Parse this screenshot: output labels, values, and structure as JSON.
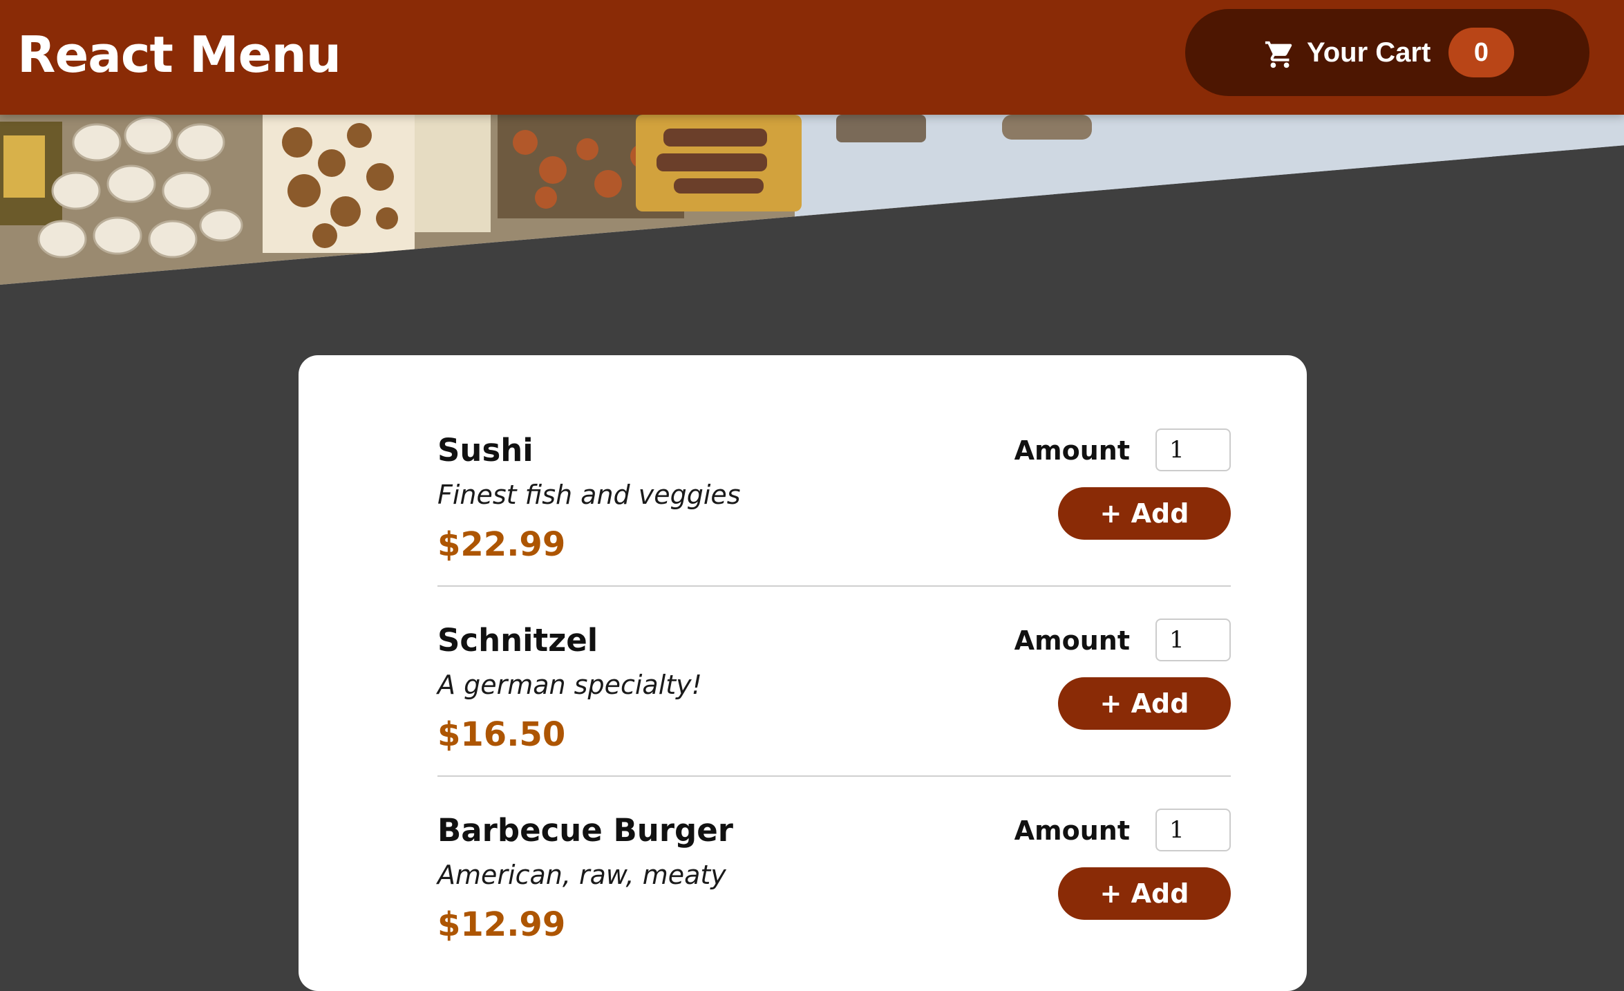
{
  "header": {
    "title": "React Menu",
    "cart": {
      "icon": "shopping-cart-icon",
      "label": "Your Cart",
      "count": "0"
    }
  },
  "hero": {
    "image": "buffet-table-food-photo"
  },
  "meals": [
    {
      "name": "Sushi",
      "description": "Finest fish and veggies",
      "price": "$22.99",
      "amount_label": "Amount",
      "amount_value": "1",
      "add_label": "+ Add"
    },
    {
      "name": "Schnitzel",
      "description": "A german specialty!",
      "price": "$16.50",
      "amount_label": "Amount",
      "amount_value": "1",
      "add_label": "+ Add"
    },
    {
      "name": "Barbecue Burger",
      "description": "American, raw, meaty",
      "price": "$12.99",
      "amount_label": "Amount",
      "amount_value": "1",
      "add_label": "+ Add"
    }
  ],
  "colors": {
    "header_bg": "#8a2b06",
    "cart_button_bg": "#4d1601",
    "cart_badge_bg": "#b94517",
    "price": "#ad5502",
    "page_bg": "#3f3f3f",
    "card_bg": "#ffffff"
  }
}
